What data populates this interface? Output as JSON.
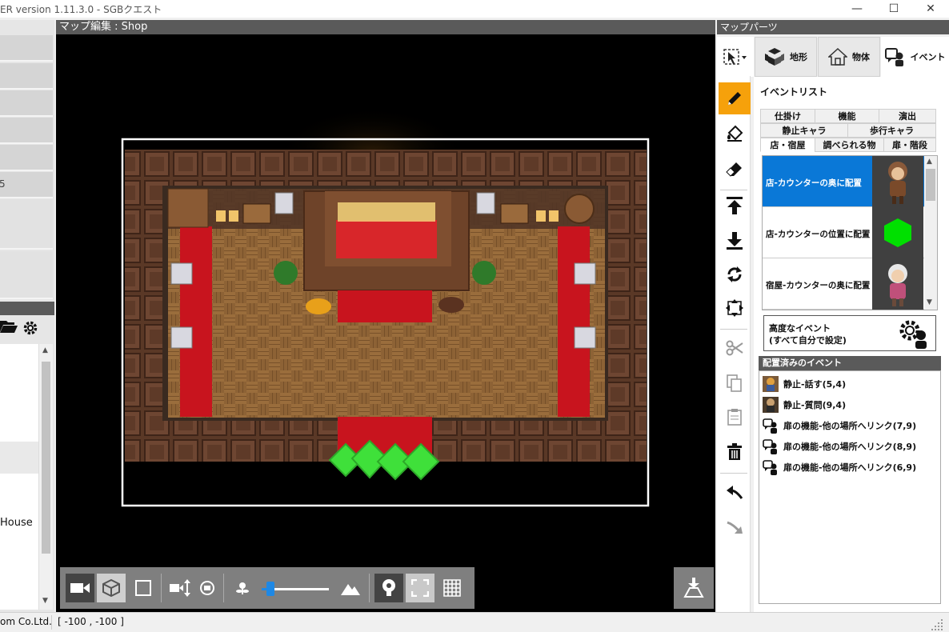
{
  "window": {
    "title": "ER version 1.11.3.0 - SGBクエスト",
    "controls": [
      "—",
      "☐",
      "✕"
    ]
  },
  "left_panel": {
    "partial_label": "5",
    "list_items": [
      "House"
    ]
  },
  "map_editor": {
    "header": "マップ編集 : Shop",
    "zoom_slider": 0.13
  },
  "right_panel": {
    "header": "マップパーツ",
    "tabs": [
      {
        "label": "地形",
        "icon": "terrain-cubes-icon"
      },
      {
        "label": "物体",
        "icon": "house-icon"
      },
      {
        "label": "イベント",
        "icon": "event-person-icon"
      }
    ],
    "active_tab": "イベント",
    "event_list_title": "イベントリスト",
    "categories_row1": [
      "仕掛け",
      "機能",
      "演出"
    ],
    "categories_row2": [
      "静止キャラ",
      "歩行キャラ"
    ],
    "categories_row3": [
      "店・宿屋",
      "調べられる物",
      "扉・階段"
    ],
    "selected_category": "店・宿屋",
    "events": [
      {
        "label": "店-カウンターの奥に配置",
        "selected": true
      },
      {
        "label": "店-カウンターの位置に配置",
        "selected": false
      },
      {
        "label": "宿屋-カウンターの奥に配置",
        "selected": false
      }
    ],
    "advanced_line1": "高度なイベント",
    "advanced_line2": "(すべて自分で設定)",
    "placed_header": "配置済みのイベント",
    "placed_events": [
      "静止-話す(5,4)",
      "静止-質問(9,4)",
      "扉の機能-他の場所へリンク(7,9)",
      "扉の機能-他の場所へリンク(8,9)",
      "扉の機能-他の場所へリンク(6,9)"
    ]
  },
  "status_bar": {
    "copyright": "om Co.Ltd.",
    "coords": "[ -100 , -100 ]"
  },
  "colors": {
    "accent_active_tool": "#f6a10b",
    "selection_blue": "#0a78d7",
    "panel_header": "#5a5a5a",
    "map_carpet": "#c8141e",
    "map_floor": "#8a6438"
  }
}
